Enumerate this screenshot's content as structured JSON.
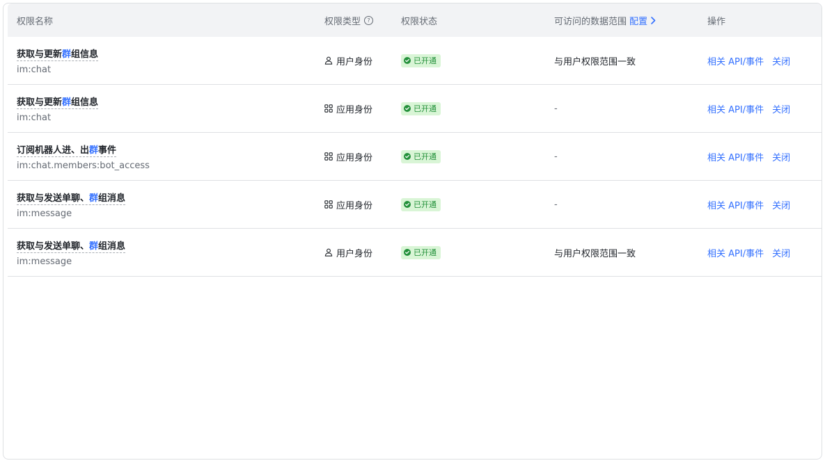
{
  "header": {
    "col_name": "权限名称",
    "col_type": "权限类型",
    "col_status": "权限状态",
    "col_scope": "可访问的数据范围",
    "col_scope_config": "配置",
    "col_ops": "操作",
    "help_glyph": "?"
  },
  "rows": [
    {
      "title_before": "获取与更新",
      "title_highlight": "群",
      "title_after": "组信息",
      "code": "im:chat",
      "type_icon": "user-icon",
      "type": "用户身份",
      "status": "已开通",
      "scope": "与用户权限范围一致",
      "op_related": "相关 API/事件",
      "op_close": "关闭"
    },
    {
      "title_before": "获取与更新",
      "title_highlight": "群",
      "title_after": "组信息",
      "code": "im:chat",
      "type_icon": "app-grid-icon",
      "type": "应用身份",
      "status": "已开通",
      "scope": "-",
      "op_related": "相关 API/事件",
      "op_close": "关闭"
    },
    {
      "title_before": "订阅机器人进、出",
      "title_highlight": "群",
      "title_after": "事件",
      "code": "im:chat.members:bot_access",
      "type_icon": "app-grid-icon",
      "type": "应用身份",
      "status": "已开通",
      "scope": "-",
      "op_related": "相关 API/事件",
      "op_close": "关闭"
    },
    {
      "title_before": "获取与发送单聊、",
      "title_highlight": "群",
      "title_after": "组消息",
      "code": "im:message",
      "type_icon": "app-grid-icon",
      "type": "应用身份",
      "status": "已开通",
      "scope": "-",
      "op_related": "相关 API/事件",
      "op_close": "关闭"
    },
    {
      "title_before": "获取与发送单聊、",
      "title_highlight": "群",
      "title_after": "组消息",
      "code": "im:message",
      "type_icon": "user-icon",
      "type": "用户身份",
      "status": "已开通",
      "scope": "与用户权限范围一致",
      "op_related": "相关 API/事件",
      "op_close": "关闭"
    }
  ],
  "colors": {
    "accent": "#3370ff",
    "status_bg": "#d9f5d6",
    "status_fg": "#24913b",
    "header_bg": "#f2f3f5"
  }
}
